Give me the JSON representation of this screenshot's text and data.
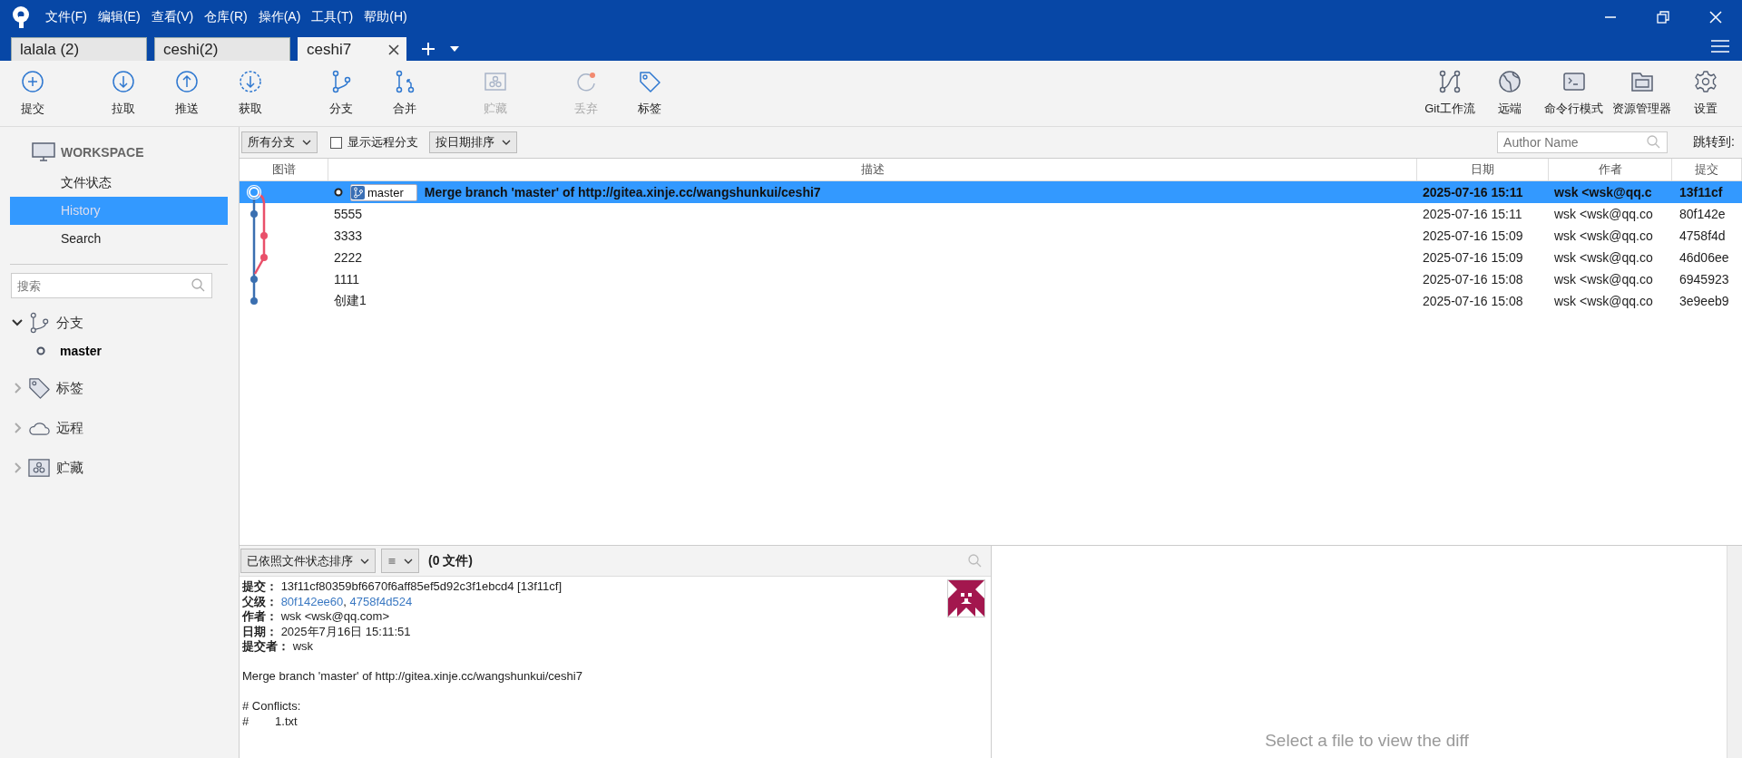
{
  "window": {
    "menu": [
      "文件(F)",
      "编辑(E)",
      "查看(V)",
      "仓库(R)",
      "操作(A)",
      "工具(T)",
      "帮助(H)"
    ]
  },
  "tabs": [
    {
      "label": "lalala (2)",
      "selected": false
    },
    {
      "label": "ceshi(2)",
      "selected": false
    },
    {
      "label": "ceshi7",
      "selected": true
    }
  ],
  "toolbar": {
    "left": [
      {
        "label": "提交",
        "kind": "commit",
        "disabled": false
      },
      {
        "label": "拉取",
        "kind": "pull",
        "disabled": false
      },
      {
        "label": "推送",
        "kind": "push",
        "disabled": false
      },
      {
        "label": "获取",
        "kind": "fetch",
        "disabled": false
      },
      {
        "label": "分支",
        "kind": "branch",
        "disabled": false
      },
      {
        "label": "合并",
        "kind": "merge",
        "disabled": false
      },
      {
        "label": "贮藏",
        "kind": "stash",
        "disabled": true
      },
      {
        "label": "丢弃",
        "kind": "discard",
        "disabled": true
      },
      {
        "label": "标签",
        "kind": "tag",
        "disabled": false
      }
    ],
    "right": [
      {
        "label": "Git工作流",
        "kind": "gitflow",
        "disabled": false
      },
      {
        "label": "远端",
        "kind": "remote",
        "disabled": false
      },
      {
        "label": "命令行模式",
        "kind": "terminal",
        "disabled": false
      },
      {
        "label": "资源管理器",
        "kind": "explorer",
        "disabled": false
      },
      {
        "label": "设置",
        "kind": "settings",
        "disabled": false
      }
    ]
  },
  "sidebar": {
    "workspace": {
      "title": "WORKSPACE",
      "items": [
        {
          "label": "文件状态",
          "selected": false
        },
        {
          "label": "History",
          "selected": true
        },
        {
          "label": "Search",
          "selected": false
        }
      ]
    },
    "search": {
      "placeholder": "搜索"
    },
    "sections": [
      {
        "label": "分支",
        "kind": "branch",
        "expanded": true,
        "children": [
          {
            "label": "master",
            "current": true
          }
        ]
      },
      {
        "label": "标签",
        "kind": "tag",
        "expanded": false
      },
      {
        "label": "远程",
        "kind": "remote",
        "expanded": false
      },
      {
        "label": "贮藏",
        "kind": "stash",
        "expanded": false
      }
    ]
  },
  "filter_bar": {
    "branch_filter": "所有分支",
    "show_remote": {
      "label": "显示远程分支",
      "checked": false
    },
    "sort": "按日期排序",
    "author_search": {
      "placeholder": "Author Name"
    },
    "jump_label": "跳转到:"
  },
  "table": {
    "columns": [
      "图谱",
      "描述",
      "日期",
      "作者",
      "提交"
    ],
    "rows": [
      {
        "branches": [
          "master"
        ],
        "description": "Merge branch 'master' of http://gitea.xinje.cc/wangshunkui/ceshi7",
        "date": "2025-07-16 15:11",
        "author": "wsk <wsk@qq.c",
        "commit": "13f11cf",
        "selected": true
      },
      {
        "description": "5555",
        "date": "2025-07-16 15:11",
        "author": "wsk <wsk@qq.co",
        "commit": "80f142e",
        "selected": false
      },
      {
        "description": "3333",
        "date": "2025-07-16 15:09",
        "author": "wsk <wsk@qq.co",
        "commit": "4758f4d",
        "selected": false
      },
      {
        "description": "2222",
        "date": "2025-07-16 15:09",
        "author": "wsk <wsk@qq.co",
        "commit": "46d06ee",
        "selected": false
      },
      {
        "description": "1111",
        "date": "2025-07-16 15:08",
        "author": "wsk <wsk@qq.co",
        "commit": "6945923",
        "selected": false
      },
      {
        "description": "创建1",
        "date": "2025-07-16 15:08",
        "author": "wsk <wsk@qq.co",
        "commit": "3e9eeb9",
        "selected": false
      }
    ]
  },
  "file_panel": {
    "sort": "已依照文件状态排序",
    "count": "(0 文件)"
  },
  "details": {
    "fields": [
      {
        "label": "提交：",
        "value": "13f11cf80359bf6670f6aff85ef5d92c3f1ebcd4 [13f11cf]"
      },
      {
        "label": "父级：",
        "links": [
          "80f142ee60",
          "4758f4d524"
        ],
        "separator": ","
      },
      {
        "label": "作者：",
        "value": "wsk <wsk@qq.com>"
      },
      {
        "label": "日期：",
        "value": "2025年7月16日 15:11:51"
      },
      {
        "label": "提交者：",
        "value": "wsk"
      }
    ],
    "message": [
      "Merge branch 'master' of http://gitea.xinje.cc/wangshunkui/ceshi7",
      "# Conflicts:\n#        1.txt"
    ]
  },
  "diff_panel": {
    "placeholder": "Select a file to view the diff"
  }
}
